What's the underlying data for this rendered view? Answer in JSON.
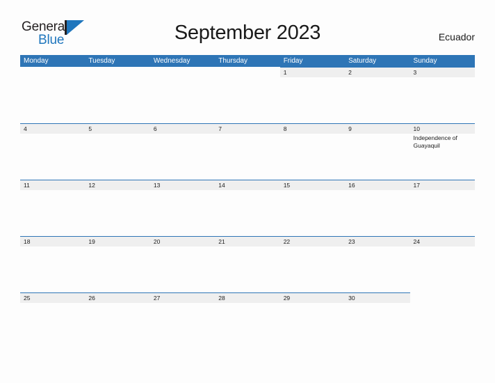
{
  "brand": {
    "name_part1": "General",
    "name_part2": "Blue",
    "flag_icon": "flag-icon",
    "accent_color": "#1f76bd"
  },
  "header": {
    "title": "September 2023",
    "region": "Ecuador"
  },
  "calendar": {
    "header_bg_color": "#2e75b6",
    "band_bg_color": "#efefef",
    "weekdays": [
      "Monday",
      "Tuesday",
      "Wednesday",
      "Thursday",
      "Friday",
      "Saturday",
      "Sunday"
    ],
    "weeks": [
      [
        {
          "day": "",
          "filled": false,
          "events": []
        },
        {
          "day": "",
          "filled": false,
          "events": []
        },
        {
          "day": "",
          "filled": false,
          "events": []
        },
        {
          "day": "",
          "filled": false,
          "events": []
        },
        {
          "day": "1",
          "filled": true,
          "events": []
        },
        {
          "day": "2",
          "filled": true,
          "events": []
        },
        {
          "day": "3",
          "filled": true,
          "events": []
        }
      ],
      [
        {
          "day": "4",
          "filled": true,
          "events": []
        },
        {
          "day": "5",
          "filled": true,
          "events": []
        },
        {
          "day": "6",
          "filled": true,
          "events": []
        },
        {
          "day": "7",
          "filled": true,
          "events": []
        },
        {
          "day": "8",
          "filled": true,
          "events": []
        },
        {
          "day": "9",
          "filled": true,
          "events": []
        },
        {
          "day": "10",
          "filled": true,
          "events": [
            "Independence of Guayaquil"
          ]
        }
      ],
      [
        {
          "day": "11",
          "filled": true,
          "events": []
        },
        {
          "day": "12",
          "filled": true,
          "events": []
        },
        {
          "day": "13",
          "filled": true,
          "events": []
        },
        {
          "day": "14",
          "filled": true,
          "events": []
        },
        {
          "day": "15",
          "filled": true,
          "events": []
        },
        {
          "day": "16",
          "filled": true,
          "events": []
        },
        {
          "day": "17",
          "filled": true,
          "events": []
        }
      ],
      [
        {
          "day": "18",
          "filled": true,
          "events": []
        },
        {
          "day": "19",
          "filled": true,
          "events": []
        },
        {
          "day": "20",
          "filled": true,
          "events": []
        },
        {
          "day": "21",
          "filled": true,
          "events": []
        },
        {
          "day": "22",
          "filled": true,
          "events": []
        },
        {
          "day": "23",
          "filled": true,
          "events": []
        },
        {
          "day": "24",
          "filled": true,
          "events": []
        }
      ],
      [
        {
          "day": "25",
          "filled": true,
          "events": []
        },
        {
          "day": "26",
          "filled": true,
          "events": []
        },
        {
          "day": "27",
          "filled": true,
          "events": []
        },
        {
          "day": "28",
          "filled": true,
          "events": []
        },
        {
          "day": "29",
          "filled": true,
          "events": []
        },
        {
          "day": "30",
          "filled": true,
          "events": []
        },
        {
          "day": "",
          "filled": false,
          "events": []
        }
      ]
    ]
  }
}
